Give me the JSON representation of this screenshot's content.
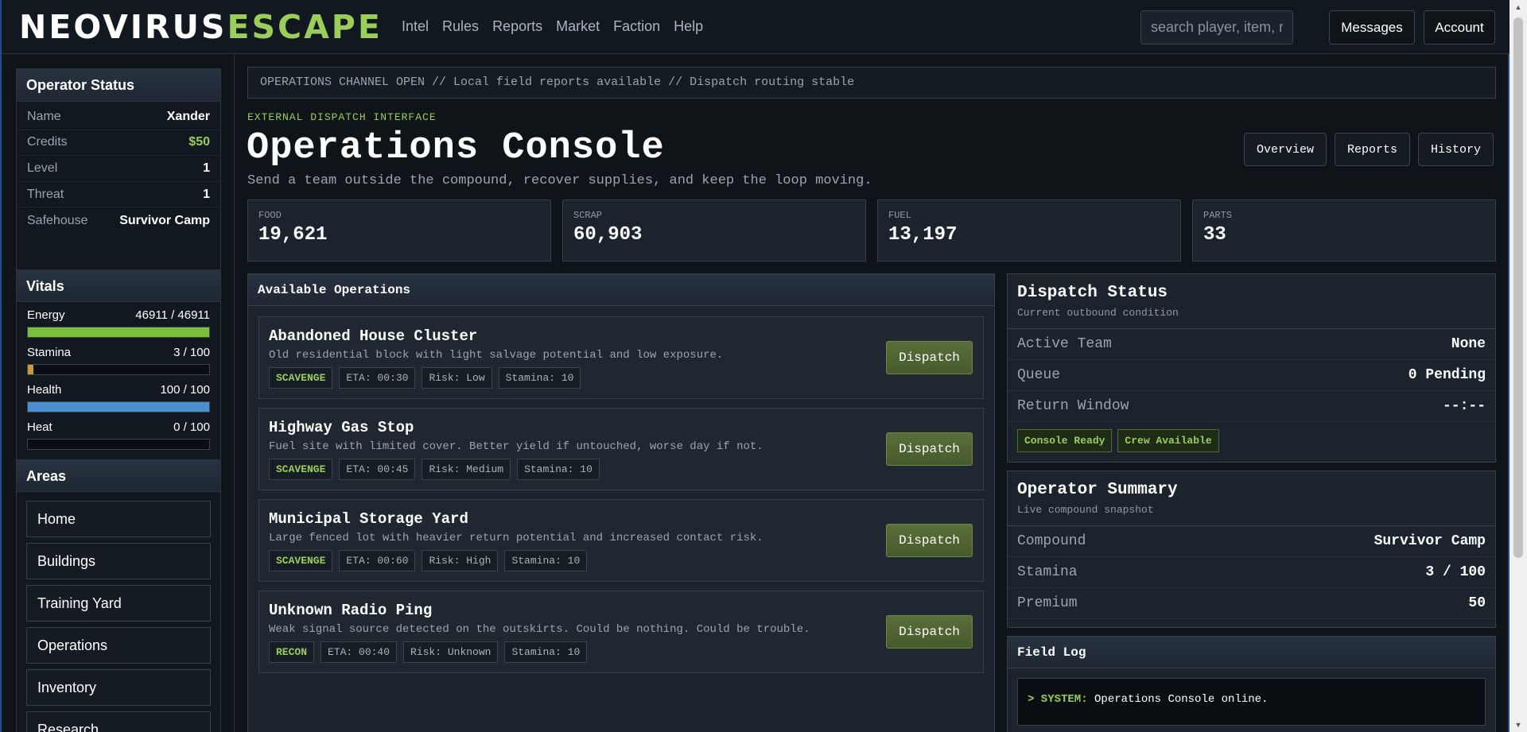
{
  "brand": {
    "part1": "NEOVIRUS",
    "part2": "ESCAPE"
  },
  "nav": [
    "Intel",
    "Rules",
    "Reports",
    "Market",
    "Faction",
    "Help"
  ],
  "search": {
    "placeholder": "search player, item, npc..."
  },
  "header_buttons": {
    "messages": "Messages",
    "account": "Account"
  },
  "operator_status": {
    "title": "Operator Status",
    "rows": [
      {
        "key": "Name",
        "value": "Xander"
      },
      {
        "key": "Credits",
        "value": "$50"
      },
      {
        "key": "Level",
        "value": "1"
      },
      {
        "key": "Threat",
        "value": "1"
      },
      {
        "key": "Safehouse",
        "value": "Survivor Camp"
      }
    ]
  },
  "vitals": {
    "title": "Vitals",
    "items": [
      {
        "label": "Energy",
        "value": "46911 / 46911",
        "fraction": 1.0
      },
      {
        "label": "Stamina",
        "value": "3 / 100",
        "fraction": 0.03
      },
      {
        "label": "Health",
        "value": "100 / 100",
        "fraction": 1.0
      },
      {
        "label": "Heat",
        "value": "0 / 100",
        "fraction": 0.0
      }
    ]
  },
  "areas": {
    "title": "Areas",
    "items": [
      "Home",
      "Buildings",
      "Training Yard",
      "Operations",
      "Inventory",
      "Research"
    ]
  },
  "ticker": "OPERATIONS CHANNEL OPEN // Local field reports available // Dispatch routing stable",
  "eyebrow": "EXTERNAL DISPATCH INTERFACE",
  "page_title": "Operations Console",
  "page_subtitle": "Send a team outside the compound, recover supplies, and keep the loop moving.",
  "view_buttons": [
    "Overview",
    "Reports",
    "History"
  ],
  "resources": [
    {
      "label": "FOOD",
      "value": "19,621"
    },
    {
      "label": "SCRAP",
      "value": "60,903"
    },
    {
      "label": "FUEL",
      "value": "13,197"
    },
    {
      "label": "PARTS",
      "value": "33"
    }
  ],
  "operations": {
    "title": "Available Operations",
    "dispatch_label": "Dispatch",
    "items": [
      {
        "name": "Abandoned House Cluster",
        "desc": "Old residential block with light salvage potential and low exposure.",
        "type": "SCAVENGE",
        "eta": "ETA: 00:30",
        "risk": "Risk: Low",
        "stamina": "Stamina: 10"
      },
      {
        "name": "Highway Gas Stop",
        "desc": "Fuel site with limited cover. Better yield if untouched, worse day if not.",
        "type": "SCAVENGE",
        "eta": "ETA: 00:45",
        "risk": "Risk: Medium",
        "stamina": "Stamina: 10"
      },
      {
        "name": "Municipal Storage Yard",
        "desc": "Large fenced lot with heavier return potential and increased contact risk.",
        "type": "SCAVENGE",
        "eta": "ETA: 00:60",
        "risk": "Risk: High",
        "stamina": "Stamina: 10"
      },
      {
        "name": "Unknown Radio Ping",
        "desc": "Weak signal source detected on the outskirts. Could be nothing. Could be trouble.",
        "type": "RECON",
        "eta": "ETA: 00:40",
        "risk": "Risk: Unknown",
        "stamina": "Stamina: 10"
      }
    ]
  },
  "dispatch_status": {
    "title": "Dispatch Status",
    "subtitle": "Current outbound condition",
    "rows": [
      {
        "key": "Active Team",
        "value": "None"
      },
      {
        "key": "Queue",
        "value": "0 Pending"
      },
      {
        "key": "Return Window",
        "value": "--:--"
      }
    ],
    "badges": [
      "Console Ready",
      "Crew Available"
    ]
  },
  "operator_summary": {
    "title": "Operator Summary",
    "subtitle": "Live compound snapshot",
    "rows": [
      {
        "key": "Compound",
        "value": "Survivor Camp"
      },
      {
        "key": "Stamina",
        "value": "3 / 100"
      },
      {
        "key": "Premium",
        "value": "50"
      }
    ]
  },
  "field_log": {
    "title": "Field Log",
    "entries": [
      {
        "prefix": "> SYSTEM:",
        "text": "Operations Console online."
      }
    ]
  },
  "colors": {
    "accent": "#9acd5a",
    "background": "#0f1419",
    "panel": "#1b232d"
  }
}
